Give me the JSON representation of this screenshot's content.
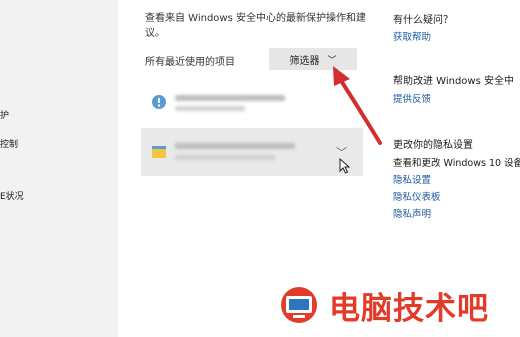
{
  "sidebar": {
    "items": [
      "护",
      "控制",
      "E状况"
    ]
  },
  "main": {
    "description": "查看来自 Windows 安全中心的最新保护操作和建议。",
    "recent_label": "所有最近使用的项目",
    "filter_label": "筛选器"
  },
  "right": {
    "question_heading": "有什么疑问？",
    "get_help": "获取帮助",
    "improve_heading": "帮助改进 Windows 安全中",
    "feedback": "提供反馈",
    "privacy_heading": "更改你的隐私设置",
    "privacy_desc": "查看和更改 Windows 10 设备",
    "privacy_settings": "隐私设置",
    "privacy_dashboard": "隐私仪表板",
    "privacy_statement": "隐私声明"
  },
  "watermark": {
    "text": "电脑技术吧"
  },
  "colors": {
    "link": "#1e5aa0",
    "arrow": "#d32f2f",
    "watermark": "#e23b2a"
  }
}
